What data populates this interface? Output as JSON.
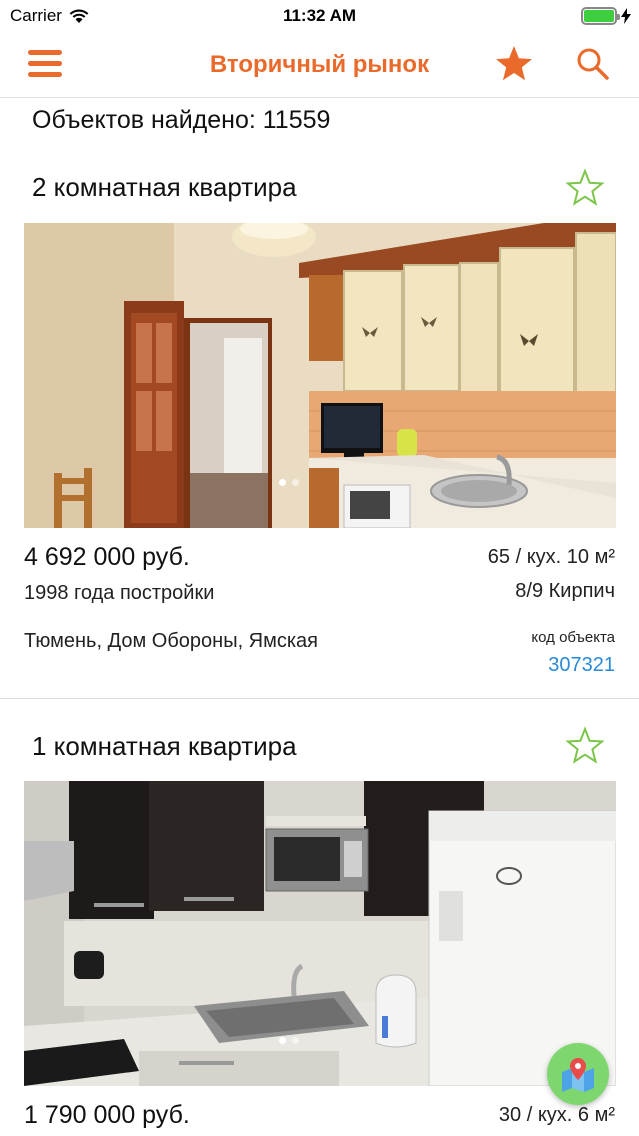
{
  "status_bar": {
    "carrier": "Carrier",
    "time": "11:32 AM"
  },
  "nav": {
    "title": "Вторичный рынок",
    "menu_icon": "hamburger-menu-icon",
    "favorites_icon": "star-icon",
    "search_icon": "search-icon"
  },
  "results": {
    "found_text": "Объектов найдено: 11559"
  },
  "colors": {
    "accent": "#e96a2b",
    "link": "#2a8ad8",
    "favorite": "#7cc54b",
    "map_button": "#7ed66f"
  },
  "listings": [
    {
      "title": "2 комнатная квартира",
      "price": "4 692 000 руб.",
      "area": "65 / кух. 10 м²",
      "year": "1998 года постройки",
      "floor_material": "8/9 Кирпич",
      "address": "Тюмень, Дом Обороны, Ямская",
      "code_label": "код объекта",
      "code": "307321",
      "photo": "kitchen-photo"
    },
    {
      "title": "1 комнатная квартира",
      "price": "1 790 000 руб.",
      "area": "30 / кух. 6 м²",
      "photo": "kitchen-photo"
    }
  ],
  "map_button": {
    "icon": "map-pin-icon"
  }
}
